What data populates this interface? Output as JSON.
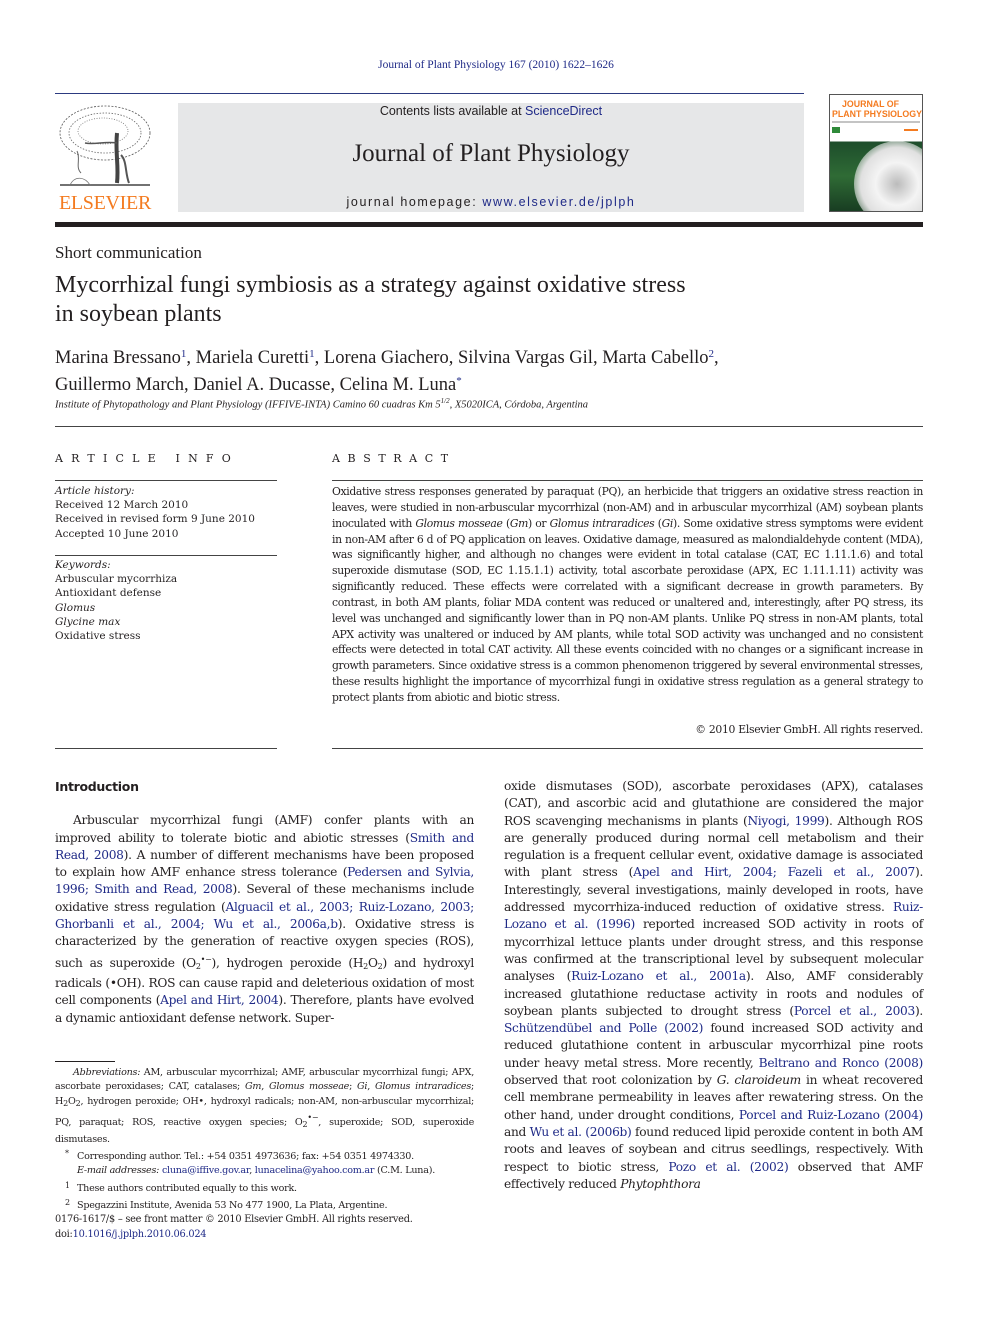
{
  "running_head": "Journal of Plant Physiology 167 (2010) 1622–1626",
  "header": {
    "publisher_logo_text": "ELSEVIER",
    "contents_prefix": "Contents lists available at ",
    "contents_link": "ScienceDirect",
    "journal_name": "Journal of Plant Physiology",
    "homepage_prefix": "journal homepage: ",
    "homepage_link": "www.elsevier.de/jplph",
    "cover_title_line1": "JOURNAL OF",
    "cover_title_line2": "PLANT PHYSIOLOGY"
  },
  "article": {
    "type": "Short communication",
    "title_line1": "Mycorrhizal fungi symbiosis as a strategy against oxidative stress",
    "title_line2": "in soybean plants",
    "authors": [
      {
        "name": "Marina Bressano",
        "mark": "1"
      },
      {
        "name": "Mariela Curetti",
        "mark": "1"
      },
      {
        "name": "Lorena Giachero",
        "mark": ""
      },
      {
        "name": "Silvina Vargas Gil",
        "mark": ""
      },
      {
        "name": "Marta Cabello",
        "mark": "2"
      },
      {
        "name": "Guillermo March",
        "mark": ""
      },
      {
        "name": "Daniel A. Ducasse",
        "mark": ""
      },
      {
        "name": "Celina M. Luna",
        "mark": "*"
      }
    ],
    "affiliation_pre": "Institute of Phytopathology and Plant Physiology (IFFIVE-INTA) Camino 60 cuadras Km 5",
    "affiliation_sup": "1/2",
    "affiliation_post": ", X5020ICA, Córdoba, Argentina"
  },
  "article_info": {
    "heading": "ARTICLE INFO",
    "history_label": "Article history:",
    "history": [
      "Received 12 March 2010",
      "Received in revised form 9 June 2010",
      "Accepted 10 June 2010"
    ],
    "keywords_label": "Keywords:",
    "keywords": [
      {
        "text": "Arbuscular mycorrhiza",
        "italic": false
      },
      {
        "text": "Antioxidant defense",
        "italic": false
      },
      {
        "text": "Glomus",
        "italic": true
      },
      {
        "text": "Glycine max",
        "italic": true
      },
      {
        "text": "Oxidative stress",
        "italic": false
      }
    ]
  },
  "abstract": {
    "heading": "ABSTRACT",
    "p1": "Oxidative stress responses generated by paraquat (PQ), an herbicide that triggers an oxidative stress reaction in leaves, were studied in non-arbuscular mycorrhizal (non-AM) and in arbuscular mycorrhizal (AM) soybean plants inoculated with ",
    "sp1": "Glomus mosseae",
    "p2": " (",
    "sp1_abbr": "Gm",
    "p3": ") or ",
    "sp2": "Glomus intraradices",
    "p4": " (",
    "sp2_abbr": "Gi",
    "p5": "). Some oxidative stress symptoms were evident in non-AM after 6 d of PQ application on leaves. Oxidative damage, measured as malondialdehyde content (MDA), was significantly higher, and although no changes were evident in total catalase (CAT, EC 1.11.1.6) and total superoxide dismutase (SOD, EC 1.15.1.1) activity, total ascorbate peroxidase (APX, EC 1.11.1.11) activity was significantly reduced. These effects were correlated with a significant decrease in growth parameters. By contrast, in both AM plants, foliar MDA content was reduced or unaltered and, interestingly, after PQ stress, its level was unchanged and significantly lower than in PQ non-AM plants. Unlike PQ stress in non-AM plants, total APX activity was unaltered or induced by AM plants, while total SOD activity was unchanged and no consistent effects were detected in total CAT activity. All these events coincided with no changes or a significant increase in growth parameters. Since oxidative stress is a common phenomenon triggered by several environmental stresses, these results highlight the importance of mycorrhizal fungi in oxidative stress regulation as a general strategy to protect plants from abiotic and biotic stress.",
    "copyright": "© 2010 Elsevier GmbH. All rights reserved."
  },
  "body": {
    "intro_heading": "Introduction",
    "left": [
      {
        "t": "Arbuscular mycorrhizal fungi (AMF) confer plants with an improved ability to tolerate biotic and abiotic stresses ("
      },
      {
        "l": "Smith and Read, 2008"
      },
      {
        "t": "). A number of different mechanisms have been proposed to explain how AMF enhance stress tolerance ("
      },
      {
        "l": "Pedersen and Sylvia, 1996; Smith and Read, 2008"
      },
      {
        "t": "). Several of these mechanisms include oxidative stress regulation ("
      },
      {
        "l": "Alguacil et al., 2003; Ruiz-Lozano, 2003; Ghorbanli et al., 2004; Wu et al., 2006a,b"
      },
      {
        "t": "). Oxidative stress is characterized by the generation of reactive oxygen species (ROS), such as superoxide (O"
      },
      {
        "sub": "2"
      },
      {
        "sup": "•−"
      },
      {
        "t": "), hydrogen peroxide (H"
      },
      {
        "sub": "2"
      },
      {
        "t": "O"
      },
      {
        "sub": "2"
      },
      {
        "t": ") and hydroxyl radicals (•OH). ROS can cause rapid and deleterious oxidation of most cell components ("
      },
      {
        "l": "Apel and Hirt, 2004"
      },
      {
        "t": "). Therefore, plants have evolved a dynamic antioxidant defense network. Super-"
      }
    ],
    "right": [
      {
        "t": "oxide dismutases (SOD), ascorbate peroxidases (APX), catalases (CAT), and ascorbic acid and glutathione are considered the major ROS scavenging mechanisms in plants ("
      },
      {
        "l": "Niyogi, 1999"
      },
      {
        "t": "). Although ROS are generally produced during normal cell metabolism and their regulation is a frequent cellular event, oxidative damage is associated with plant stress ("
      },
      {
        "l": "Apel and Hirt, 2004; Fazeli et al., 2007"
      },
      {
        "t": "). Interestingly, several investigations, mainly developed in roots, have addressed mycorrhiza-induced reduction of oxidative stress. "
      },
      {
        "l": "Ruiz-Lozano et al. (1996)"
      },
      {
        "t": " reported increased SOD activity in roots of mycorrhizal lettuce plants under drought stress, and this response was confirmed at the transcriptional level by subsequent molecular analyses ("
      },
      {
        "l": "Ruiz-Lozano et al., 2001a"
      },
      {
        "t": "). Also, AMF considerably increased glutathione reductase activity in roots and nodules of soybean plants subjected to drought stress ("
      },
      {
        "l": "Porcel et al., 2003"
      },
      {
        "t": "). "
      },
      {
        "l": "Schützendübel and Polle (2002)"
      },
      {
        "t": " found increased SOD activity and reduced glutathione content in arbuscular mycorrhizal pine roots under heavy metal stress. More recently, "
      },
      {
        "l": "Beltrano and Ronco (2008)"
      },
      {
        "t": " observed that root colonization by "
      },
      {
        "i": "G. claroideum"
      },
      {
        "t": " in wheat recovered cell membrane permeability in leaves after rewatering stress. On the other hand, under drought conditions, "
      },
      {
        "l": "Porcel and Ruiz-Lozano (2004)"
      },
      {
        "t": " and "
      },
      {
        "l": "Wu et al. (2006b)"
      },
      {
        "t": " found reduced lipid peroxide content in both AM roots and leaves of soybean and citrus seedlings, respectively. With respect to biotic stress, "
      },
      {
        "l": "Pozo et al. (2002)"
      },
      {
        "t": " observed that AMF effectively reduced "
      },
      {
        "i": "Phytophthora"
      }
    ]
  },
  "footnotes": {
    "abbrev": [
      {
        "i": "Abbreviations:"
      },
      {
        "t": "  AM, arbuscular mycorrhizal; AMF, arbuscular mycorrhizal fungi; APX, ascorbate peroxidases; CAT, catalases; "
      },
      {
        "i": "Gm"
      },
      {
        "t": ", "
      },
      {
        "i": "Glomus mosseae"
      },
      {
        "t": "; "
      },
      {
        "i": "Gi"
      },
      {
        "t": ", "
      },
      {
        "i": "Glomus intraradices"
      },
      {
        "t": "; H"
      },
      {
        "sub": "2"
      },
      {
        "t": "O"
      },
      {
        "sub": "2"
      },
      {
        "t": ", hydrogen peroxide; OH•, hydroxyl radicals; non-AM, non-arbuscular mycorrhizal; PQ, paraquat; ROS, reactive oxygen species; O"
      },
      {
        "sub": "2"
      },
      {
        "sup": "•−"
      },
      {
        "t": ", superoxide; SOD, superoxide dismutases."
      }
    ],
    "corresponding_mark": "*",
    "corresponding": "Corresponding author. Tel.: +54 0351 4973636; fax: +54 0351 4974330.",
    "email_label": "E-mail addresses:",
    "email1": "cluna@iffive.gov.ar",
    "email2": "lunacelina@yahoo.com.ar",
    "email_suffix": " (C.M. Luna).",
    "fn1_mark": "1",
    "fn1": "These authors contributed equally to this work.",
    "fn2_mark": "2",
    "fn2": "Spegazzini Institute, Avenida 53 No 477 1900, La Plata, Argentine."
  },
  "front_matter": {
    "issn_line": "0176-1617/$ – see front matter © 2010 Elsevier GmbH. All rights reserved.",
    "doi_prefix": "doi:",
    "doi": "10.1016/j.jplph.2010.06.024"
  },
  "colors": {
    "link": "#1f2a87",
    "elsevier_orange": "#f47b20",
    "banner_gray": "#e6e7e8",
    "text": "#231f20"
  }
}
